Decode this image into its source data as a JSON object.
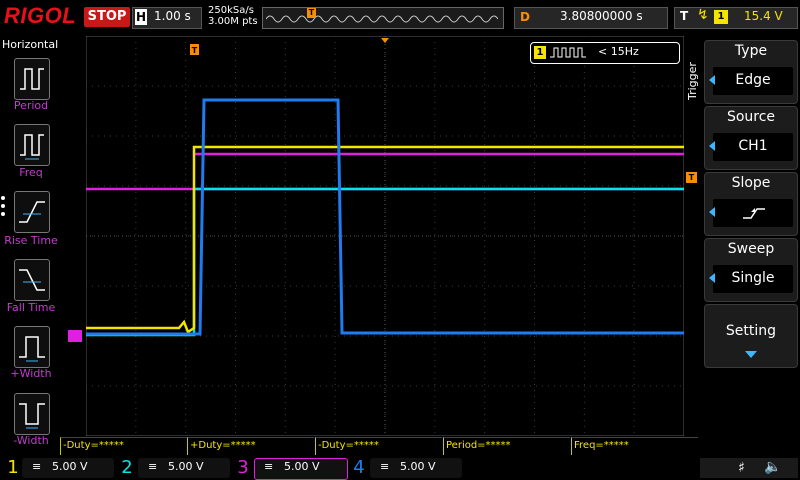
{
  "brand": "RIGOL",
  "run_state": "STOP",
  "timebase": {
    "letter": "H",
    "value": "1.00 s"
  },
  "acquisition": {
    "sample_rate": "250kSa/s",
    "memory_depth": "3.00M pts"
  },
  "memory_trigger_marker": "T",
  "delay": {
    "letter": "D",
    "value": "3.80800000 s"
  },
  "trigger": {
    "letter": "T",
    "channel": "1",
    "level": "15.4 V",
    "vertical_label": "Trigger",
    "marker": "T",
    "info_channel": "1",
    "info_text": "< 15Hz"
  },
  "left_panel": {
    "title": "Horizontal",
    "items": [
      {
        "label": "Period"
      },
      {
        "label": "Freq"
      },
      {
        "label": "Rise Time"
      },
      {
        "label": "Fall Time"
      },
      {
        "label": "+Width"
      },
      {
        "label": "-Width"
      }
    ]
  },
  "right_menu": {
    "items": [
      {
        "title": "Type",
        "value": "Edge"
      },
      {
        "title": "Source",
        "value": "CH1"
      },
      {
        "title": "Slope",
        "value": ""
      },
      {
        "title": "Sweep",
        "value": "Single"
      },
      {
        "title": "Setting",
        "value": ""
      }
    ]
  },
  "measurements": [
    "-Duty=*****",
    "+Duty=*****",
    "-Duty=*****",
    "Period=*****",
    "Freq=*****"
  ],
  "channels": [
    {
      "num": "1",
      "scale": "5.00 V",
      "color": "#f5e400"
    },
    {
      "num": "2",
      "scale": "5.00 V",
      "color": "#00e5e5"
    },
    {
      "num": "3",
      "scale": "5.00 V",
      "color": "#e020e0"
    },
    {
      "num": "4",
      "scale": "5.00 V",
      "color": "#1e7cf0"
    }
  ],
  "colors": {
    "ch1": "#f5e400",
    "ch2": "#00e5e5",
    "ch3": "#e020e0",
    "ch4": "#1e7cf0",
    "accent": "#c43cd0",
    "trigger": "#ff8c00"
  },
  "icons": [
    "usb-icon",
    "speaker-icon",
    "pulse-icon",
    "rising-edge-icon",
    "falling-edge-icon"
  ]
}
